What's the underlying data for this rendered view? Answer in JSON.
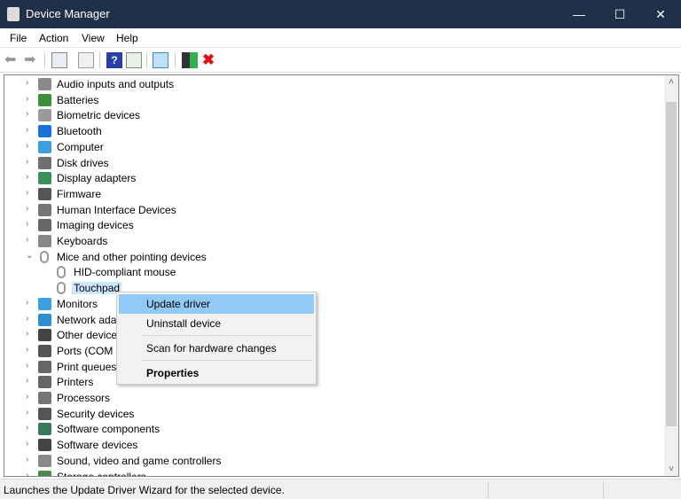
{
  "window": {
    "title": "Device Manager",
    "minimize": "—",
    "maximize": "☐",
    "close": "✕"
  },
  "menu": [
    "File",
    "Action",
    "View",
    "Help"
  ],
  "toolbar": [
    "back-icon",
    "forward-icon",
    "show-hide-console-tree-icon",
    "properties-icon",
    "help-icon",
    "action-pane-icon",
    "scan-hardware-icon",
    "update-driver-icon",
    "uninstall-icon"
  ],
  "tree": [
    {
      "label": "Audio inputs and outputs",
      "icon": "speaker",
      "color": "#8a8a8a",
      "level": 0,
      "expanded": false
    },
    {
      "label": "Batteries",
      "icon": "battery",
      "color": "#3a8f3a",
      "level": 0,
      "expanded": false
    },
    {
      "label": "Biometric devices",
      "icon": "fingerprint",
      "color": "#9a9a9a",
      "level": 0,
      "expanded": false
    },
    {
      "label": "Bluetooth",
      "icon": "bluetooth",
      "color": "#1a72d8",
      "level": 0,
      "expanded": false
    },
    {
      "label": "Computer",
      "icon": "computer",
      "color": "#3aa0e0",
      "level": 0,
      "expanded": false
    },
    {
      "label": "Disk drives",
      "icon": "disk",
      "color": "#6f6f6f",
      "level": 0,
      "expanded": false
    },
    {
      "label": "Display adapters",
      "icon": "display",
      "color": "#3a8f5a",
      "level": 0,
      "expanded": false
    },
    {
      "label": "Firmware",
      "icon": "firmware",
      "color": "#555",
      "level": 0,
      "expanded": false
    },
    {
      "label": "Human Interface Devices",
      "icon": "hid",
      "color": "#777",
      "level": 0,
      "expanded": false
    },
    {
      "label": "Imaging devices",
      "icon": "camera",
      "color": "#666",
      "level": 0,
      "expanded": false
    },
    {
      "label": "Keyboards",
      "icon": "keyboard",
      "color": "#888",
      "level": 0,
      "expanded": false
    },
    {
      "label": "Mice and other pointing devices",
      "icon": "mouse",
      "color": "#999",
      "level": 0,
      "expanded": true
    },
    {
      "label": "HID-compliant mouse",
      "icon": "mouse",
      "color": "#999",
      "level": 1
    },
    {
      "label": "Touchpad",
      "icon": "mouse",
      "color": "#999",
      "level": 1,
      "selected": true
    },
    {
      "label": "Monitors",
      "icon": "monitor",
      "color": "#3aa0e0",
      "level": 0,
      "expanded": false
    },
    {
      "label": "Network adapters",
      "icon": "network",
      "color": "#2d8fd0",
      "level": 0,
      "expanded": false
    },
    {
      "label": "Other devices",
      "icon": "unknown-device",
      "color": "#444",
      "level": 0,
      "expanded": false
    },
    {
      "label": "Ports (COM & LPT)",
      "icon": "port",
      "color": "#555",
      "level": 0,
      "expanded": false
    },
    {
      "label": "Print queues",
      "icon": "printer",
      "color": "#666",
      "level": 0,
      "expanded": false
    },
    {
      "label": "Printers",
      "icon": "printer",
      "color": "#666",
      "level": 0,
      "expanded": false
    },
    {
      "label": "Processors",
      "icon": "chip",
      "color": "#777",
      "level": 0,
      "expanded": false
    },
    {
      "label": "Security devices",
      "icon": "security",
      "color": "#555",
      "level": 0,
      "expanded": false
    },
    {
      "label": "Software components",
      "icon": "component",
      "color": "#3a7a5a",
      "level": 0,
      "expanded": false
    },
    {
      "label": "Software devices",
      "icon": "device",
      "color": "#444",
      "level": 0,
      "expanded": false
    },
    {
      "label": "Sound, video and game controllers",
      "icon": "speaker",
      "color": "#8a8a8a",
      "level": 0,
      "expanded": false
    },
    {
      "label": "Storage controllers",
      "icon": "storage",
      "color": "#4a8a4a",
      "level": 0,
      "expanded": false
    }
  ],
  "context_menu": {
    "items": [
      "Update driver",
      "Uninstall device",
      "Scan for hardware changes",
      "Properties"
    ]
  },
  "status": {
    "text": "Launches the Update Driver Wizard for the selected device."
  }
}
